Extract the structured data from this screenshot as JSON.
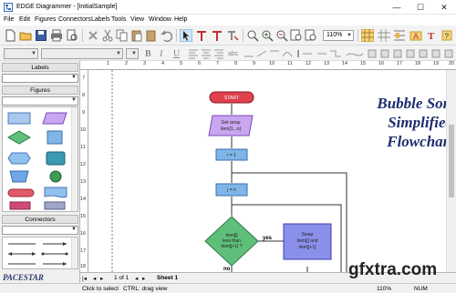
{
  "window": {
    "title": "EDGE Diagrammer - [InitialSample]",
    "minimize": "—",
    "maximize": "☐",
    "close": "✕"
  },
  "menu": [
    "File",
    "Edit",
    "Figures",
    "Connectors",
    "Labels",
    "Tools",
    "View",
    "Window",
    "Help"
  ],
  "toolbar": {
    "zoom_value": "110%"
  },
  "format": {
    "bold": "B",
    "italic": "I",
    "underline": "U",
    "abc": "abc"
  },
  "left_panel": {
    "labels_header": "Labels",
    "figures_header": "Figures",
    "connectors_header": "Connectors"
  },
  "rulers": {
    "top": [
      "1",
      "2",
      "3",
      "4",
      "5",
      "6",
      "7",
      "8",
      "9",
      "10",
      "11",
      "12",
      "13",
      "14",
      "15",
      "16",
      "17",
      "18",
      "19",
      "20"
    ],
    "left": [
      "7",
      "8",
      "9",
      "10",
      "11",
      "12",
      "13",
      "14",
      "15",
      "16",
      "17",
      "18",
      "19"
    ]
  },
  "diagram": {
    "title_lines": [
      "Bubble Sort",
      "Simplified",
      "Flowchart"
    ],
    "start": "START",
    "get_array": [
      "Get array",
      "item[1...n]"
    ],
    "i_assign": "i = 1",
    "j_assign": "j = n",
    "decision": [
      "item[j]",
      "less than",
      "item[j+1] ?"
    ],
    "swap": [
      "Swap",
      "item[j] and",
      "item[j+1]"
    ],
    "yes": "yes",
    "no": "no"
  },
  "tabs": {
    "page": "1 of 1",
    "sheet": "Sheet 1"
  },
  "status": {
    "hint": "Click to select",
    "ctrl": "CTRL: drag view",
    "zoom": "110%",
    "num": "NUM"
  },
  "branding": {
    "logo": "PACESTAR",
    "logo_sub": "SOFTWARE",
    "watermark": "gfxtra.com"
  }
}
